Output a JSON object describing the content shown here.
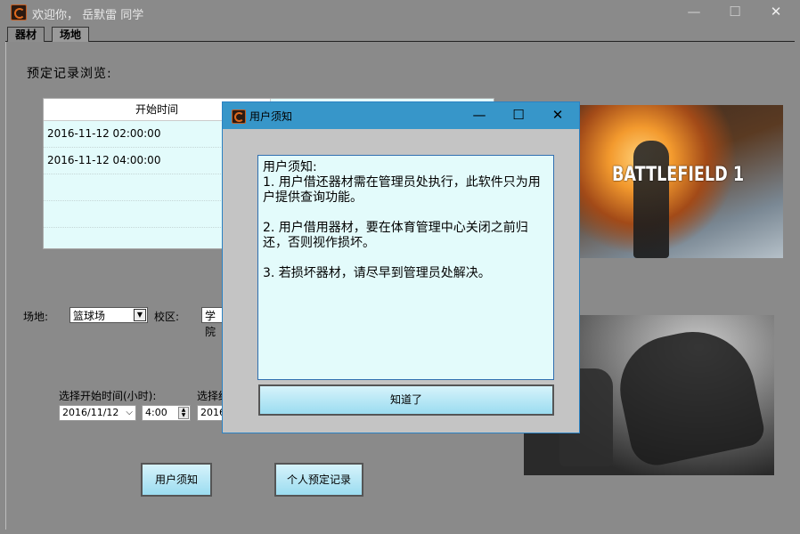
{
  "window": {
    "title": "欢迎你， 岳默雷 同学",
    "minimize": "—",
    "maximize": "☐",
    "close": "✕"
  },
  "tabs": [
    {
      "label": "器材"
    },
    {
      "label": "场地"
    }
  ],
  "booking": {
    "title": "预定记录浏览:",
    "columns": [
      "开始时间"
    ],
    "rows": [
      "2016-11-12 02:00:00",
      "2016-11-12 04:00:00"
    ]
  },
  "form": {
    "venue_label": "场地:",
    "venue_value": "篮球场",
    "campus_label": "校区:",
    "campus_value": "学院",
    "start_time_label": "选择开始时间(小时):",
    "end_time_label": "选择结",
    "start_date": "2016/11/12",
    "start_hour": "4:00",
    "end_date": "2016"
  },
  "buttons": {
    "user_notice": "用户须知",
    "my_bookings": "个人预定记录"
  },
  "images": {
    "logo_text": "BATTLEFIELD 1"
  },
  "dialog": {
    "title": "用户须知",
    "minimize": "—",
    "maximize": "☐",
    "close": "✕",
    "notice": "用户须知:\n1. 用户借还器材需在管理员处执行，此软件只为用户提供查询功能。\n\n2. 用户借用器材，要在体育管理中心关闭之前归还，否则视作损坏。\n\n3. 若损坏器材，请尽早到管理员处解决。",
    "ok": "知道了"
  }
}
